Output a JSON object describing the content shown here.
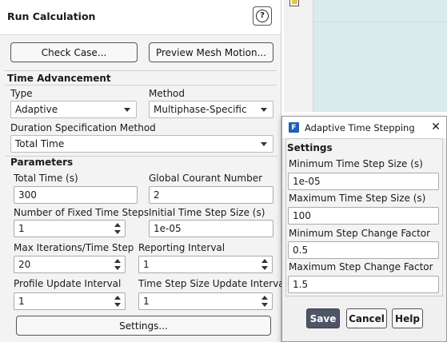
{
  "panel": {
    "title": "Run Calculation",
    "help_icon_glyph": "?",
    "check_case_label": "Check Case...",
    "preview_mesh_label": "Preview Mesh Motion...",
    "settings_label": "Settings..."
  },
  "time_advancement": {
    "title": "Time Advancement",
    "type_label": "Type",
    "type_value": "Adaptive",
    "method_label": "Method",
    "method_value": "Multiphase-Specific",
    "duration_label": "Duration Specification Method",
    "duration_value": "Total Time"
  },
  "parameters": {
    "title": "Parameters",
    "total_time_label": "Total Time (s)",
    "total_time_value": "300",
    "global_courant_label": "Global Courant Number",
    "global_courant_value": "2",
    "fixed_steps_label": "Number of Fixed Time Steps",
    "fixed_steps_value": "1",
    "initial_step_label": "Initial Time Step Size (s)",
    "initial_step_value": "1e-05",
    "max_iter_label": "Max Iterations/Time Step",
    "max_iter_value": "20",
    "reporting_label": "Reporting Interval",
    "reporting_value": "1",
    "profile_label": "Profile Update Interval",
    "profile_value": "1",
    "ts_update_label": "Time Step Size Update Interval",
    "ts_update_value": "1"
  },
  "dialog": {
    "title": "Adaptive Time Stepping",
    "close_glyph": "✕",
    "section": "Settings",
    "min_step_label": "Minimum Time Step Size (s)",
    "min_step_value": "1e-05",
    "max_step_label": "Maximum Time Step Size (s)",
    "max_step_value": "100",
    "min_factor_label": "Minimum Step Change Factor",
    "min_factor_value": "0.5",
    "max_factor_label": "Maximum Step Change Factor",
    "max_factor_value": "1.5",
    "save_label": "Save",
    "cancel_label": "Cancel",
    "help_label": "Help"
  },
  "colors": {
    "panel_bg": "#f3f3f3",
    "primary_button": "#4e5565",
    "dialog_icon": "#1f5fb8",
    "graphics_bg": "#dbeaea"
  }
}
